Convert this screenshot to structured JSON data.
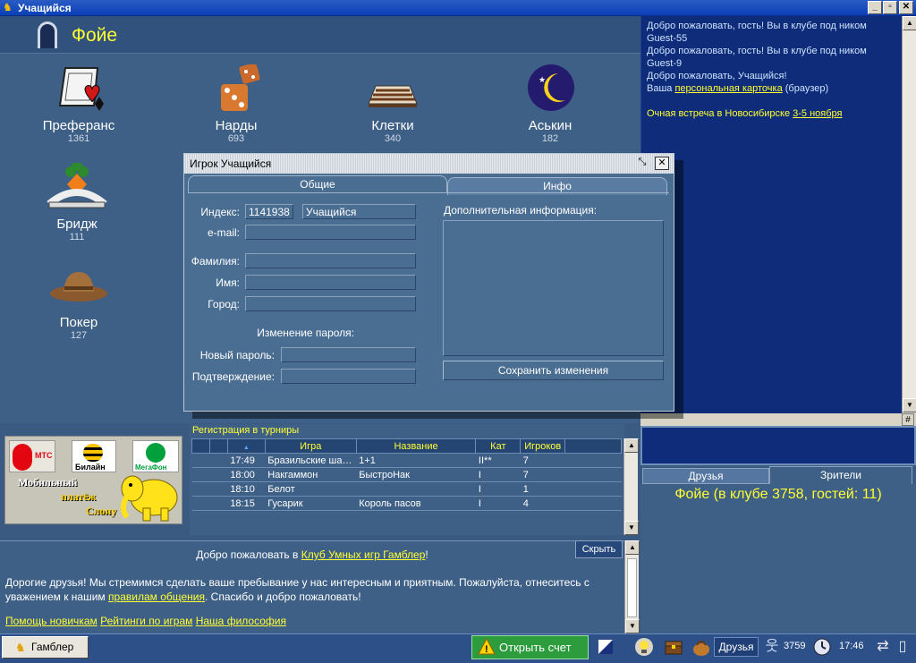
{
  "window": {
    "title": "Учащийся"
  },
  "foyer": {
    "title": "Фойе"
  },
  "games": [
    {
      "name": "Преферанс",
      "count": "1361"
    },
    {
      "name": "Нарды",
      "count": "693"
    },
    {
      "name": "Клетки",
      "count": "340"
    },
    {
      "name": "Аськин",
      "count": "182"
    },
    {
      "name": "Бридж",
      "count": "111"
    },
    {
      "name": "Покер",
      "count": "127"
    }
  ],
  "chat": {
    "lines": [
      "Добро пожаловать, гость! Вы в клубе под ником",
      "Guest-55",
      "Добро пожаловать, гость! Вы в клубе под ником",
      "Guest-9",
      "Добро пожаловать, Учащийся!"
    ],
    "card_prefix": "Ваша",
    "card_link": "персональная карточка",
    "card_suffix": "(браузер)",
    "meeting_text": "Очная встреча в Новосибирске",
    "meeting_link": "3-5 ноября",
    "scroll_corner": "#"
  },
  "dialog": {
    "title": "Игрок Учащийся",
    "tabs": [
      "Общие",
      "Инфо"
    ],
    "labels": {
      "index": "Индекс:",
      "email": "e-mail:",
      "surname": "Фамилия:",
      "name": "Имя:",
      "city": "Город:",
      "password_change": "Изменение пароля:",
      "new_password": "Новый пароль:",
      "confirm": "Подтверждение:",
      "extra_info": "Дополнительная информация:"
    },
    "values": {
      "index": "1141938",
      "nickname": "Учащийся"
    },
    "save_button": "Сохранить изменения"
  },
  "ad": {
    "mts": "МТС",
    "beeline": "Билайн",
    "megafon": "МегаФон",
    "line1": "Мобильный",
    "line2": "платёж",
    "line3": "Слону"
  },
  "tournaments": {
    "title": "Регистрация в турниры",
    "columns": [
      "",
      "",
      "",
      "Игра",
      "Название",
      "Кат",
      "Игроков",
      ""
    ],
    "sort_marker": "▲",
    "rows": [
      {
        "time": "17:49",
        "game": "Бразильские ша…",
        "name": "1+1",
        "cat": "II**",
        "players": "7"
      },
      {
        "time": "18:00",
        "game": "Накгаммон",
        "name": "БыстроНак",
        "cat": "I",
        "players": "7"
      },
      {
        "time": "18:10",
        "game": "Белот",
        "name": "",
        "cat": "I",
        "players": "1"
      },
      {
        "time": "18:15",
        "game": "Гусарик",
        "name": "Король пасов",
        "cat": "I",
        "players": "4"
      }
    ]
  },
  "right_tabs": {
    "friends": "Друзья",
    "viewers": "Зрители"
  },
  "viewers_status": "Фойе (в клубе 3758, гостей: 11)",
  "welcome": {
    "prefix": "Добро пожаловать в",
    "club_link": "Клуб Умных игр Гамблер",
    "suffix": "!",
    "body_part1": "Дорогие друзья! Мы стремимся сделать ваше пребывание у нас интересным и приятным. Пожалуйста, отнеситесь с уважением к нашим",
    "rules_link": "правилам общения",
    "body_part2": ". Спасибо и добро пожаловать!",
    "links": [
      "Помощь новичкам",
      "Рейтинги по играм",
      "Наша философия"
    ],
    "hide_button": "Скрыть"
  },
  "taskbar": {
    "start": "Гамблер",
    "open_account": "Открыть счет",
    "friends": "Друзья",
    "count": "3759",
    "time": "17:46"
  }
}
